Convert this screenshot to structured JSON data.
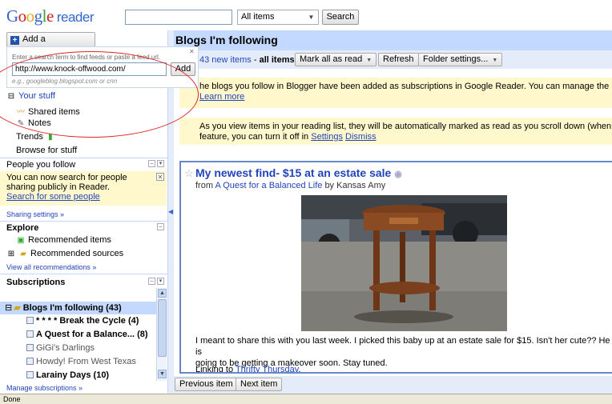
{
  "header": {
    "logo_text": [
      "G",
      "o",
      "o",
      "g",
      "l",
      "e"
    ],
    "product": "reader",
    "search_value": "",
    "search_scope": "All items",
    "search_button": "Search"
  },
  "sidebar": {
    "add_subscription": "Add a subscription",
    "popup": {
      "hint": "Enter a search term to find feeds or paste a feed url.",
      "input_value": "http://www.knock-offwood.com/",
      "add_label": "Add",
      "example": "e.g., googleblog.blogspot.com or cnn"
    },
    "your_stuff": "Your stuff",
    "shared_items": "Shared items",
    "notes": "Notes",
    "trends": "Trends",
    "browse": "Browse for stuff",
    "people_title": "People you follow",
    "people_note_line1": "You can now search for people",
    "people_note_line2": "sharing publicly in Reader.",
    "people_note_link": "Search for some people",
    "sharing_settings": "Sharing settings »",
    "explore_title": "Explore",
    "recommended_items": "Recommended items",
    "recommended_sources": "Recommended sources",
    "view_recs": "View all recommendations »",
    "subscriptions_title": "Subscriptions",
    "folder": "Blogs I'm following (43)",
    "feeds": [
      {
        "label": "* * * * Break the Cycle (4)"
      },
      {
        "label": "A Quest for a Balance... (8)"
      },
      {
        "label": "GiGi's Darlings"
      },
      {
        "label": "Howdy! From West Texas"
      },
      {
        "label": "Larainy Days (10)"
      }
    ],
    "manage": "Manage subscriptions »"
  },
  "main": {
    "title": "Blogs I'm following",
    "new_items": "43 new items",
    "sep": " - ",
    "all_items": "all items",
    "mark_all_read": "Mark all as read",
    "refresh": "Refresh",
    "folder_settings": "Folder settings...",
    "notice1_text": "he blogs you follow in Blogger have been added as subscriptions in Google Reader. You can manage the blogs y",
    "notice1_link": "Learn more",
    "notice2_text": "As you view items in your reading list, they will be automatically marked as read as you scroll down (when in the",
    "notice2_text2": "feature, you can turn it off in",
    "notice2_settings": "Settings",
    "notice2_dismiss": "Dismiss",
    "entry": {
      "title": "My newest find- $15 at an estate sale",
      "from": "from",
      "source": "A Quest for a Balanced Life",
      "by": "by Kansas Amy",
      "body_line1": "I meant to share this with you last week. I picked this baby up at an estate sale for $15. Isn't her cute?? He is",
      "body_line2": "going to be getting a makeover soon. Stay tuned.",
      "linking_to": "Linking to",
      "link": "Thrifty Thursday",
      "link_end": "."
    },
    "previous_item": "Previous item",
    "next_item": "Next item"
  },
  "status": "Done"
}
